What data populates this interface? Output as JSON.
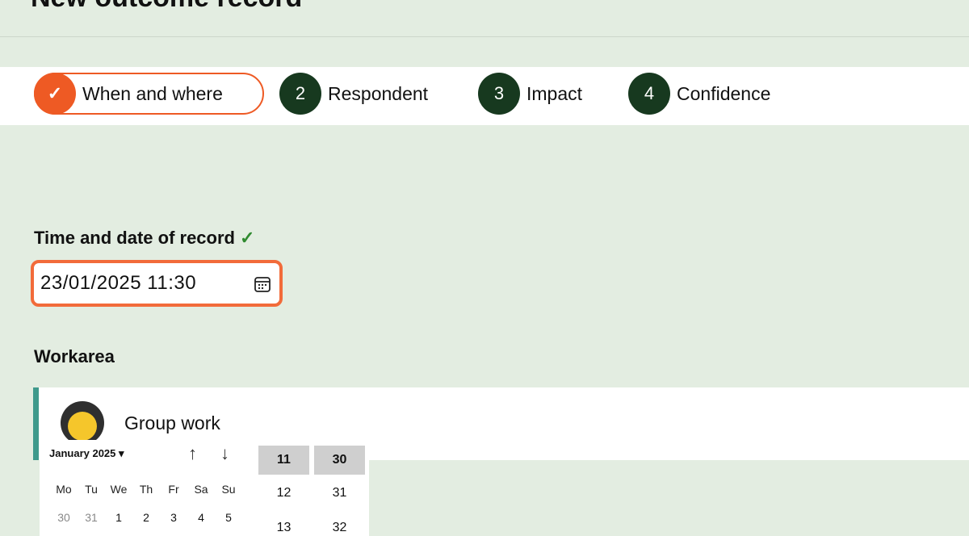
{
  "page": {
    "title": "New outcome record"
  },
  "stepper": {
    "steps": [
      {
        "marker": "✓",
        "label": "When and where"
      },
      {
        "marker": "2",
        "label": "Respondent"
      },
      {
        "marker": "3",
        "label": "Impact"
      },
      {
        "marker": "4",
        "label": "Confidence"
      }
    ]
  },
  "form": {
    "datetime": {
      "label": "Time and date of record",
      "check": "✓",
      "value": "23/01/2025 11:30"
    },
    "workarea": {
      "label": "Workarea",
      "option": "Group work"
    }
  },
  "picker": {
    "month_label": "January 2025 ▾",
    "up_arrow": "↑",
    "down_arrow": "↓",
    "weekdays": [
      "Mo",
      "Tu",
      "We",
      "Th",
      "Fr",
      "Sa",
      "Su"
    ],
    "days": [
      "30",
      "31",
      "1",
      "2",
      "3",
      "4",
      "5"
    ],
    "hours": [
      "11",
      "12",
      "13"
    ],
    "minutes": [
      "30",
      "31",
      "32"
    ]
  },
  "colors": {
    "accent": "#ee5a24",
    "step_dark": "#17391f",
    "background": "#e3ede1",
    "teal": "#3f9a8c"
  }
}
